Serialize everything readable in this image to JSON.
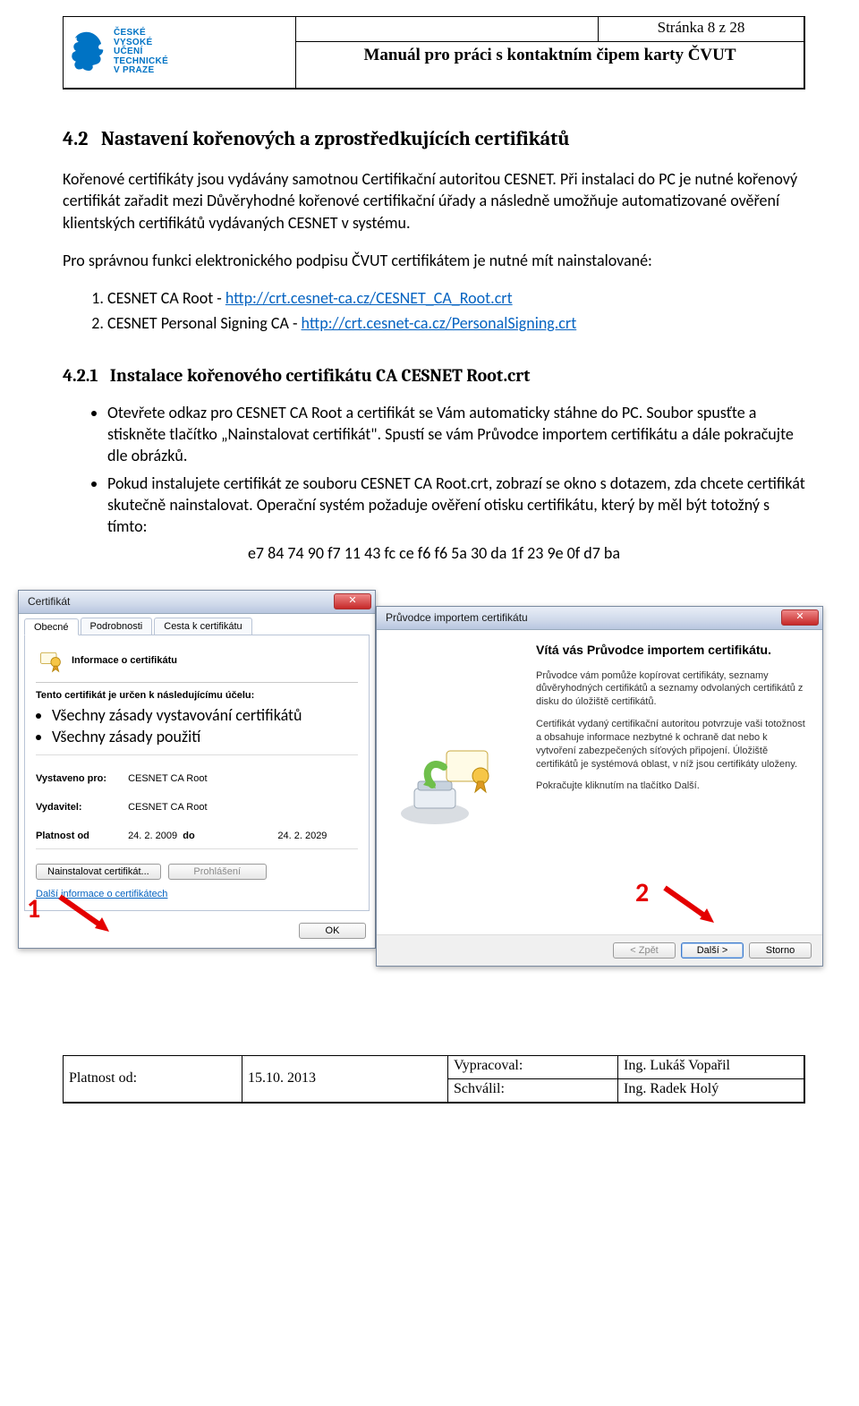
{
  "header": {
    "uni_lines": [
      "ČESKÉ",
      "VYSOKÉ",
      "UČENÍ",
      "TECHNICKÉ",
      "V PRAZE"
    ],
    "page_label": "Stránka 8 z 28",
    "title": "Manuál pro práci s kontaktním čipem karty ČVUT"
  },
  "sec": {
    "num": "4.2",
    "title": "Nastavení kořenových a zprostředkujících certifikátů",
    "p1": "Kořenové certifikáty jsou vydávány samotnou Certifikační autoritou CESNET. Při instalaci do PC je nutné kořenový certifikát zařadit mezi Důvěryhodné kořenové certifikační úřady a následně umožňuje automatizované ověření klientských certifikátů vydávaných CESNET v systému.",
    "p2": "Pro správnou funkci elektronického podpisu ČVUT certifikátem je nutné mít nainstalované:",
    "li1a": "CESNET CA Root - ",
    "li1_link": "http://crt.cesnet-ca.cz/CESNET_CA_Root.crt",
    "li2a": "CESNET Personal Signing CA - ",
    "li2_link": "http://crt.cesnet-ca.cz/PersonalSigning.crt"
  },
  "subsec": {
    "num": "4.2.1",
    "title": "Instalace kořenového certifikátu CA CESNET Root.crt",
    "b1": "Otevřete odkaz pro CESNET CA Root a certifikát se Vám automaticky stáhne do PC. Soubor spusťte a stiskněte tlačítko „Nainstalovat certifikát\". Spustí se vám Průvodce importem certifikátu a dále pokračujte dle obrázků.",
    "b2": "Pokud instalujete certifikát ze souboru CESNET CA Root.crt, zobrazí se okno s dotazem, zda chcete certifikát skutečně nainstalovat. Operační systém požaduje ověření otisku certifikátu, který by měl být totožný s tímto:",
    "hash": "e7 84 74 90 f7 11 43 fc ce f6 f6 5a 30 da 1f 23 9e 0f d7 ba"
  },
  "cert_win": {
    "title": "Certifikát",
    "tabs": [
      "Obecné",
      "Podrobnosti",
      "Cesta k certifikátu"
    ],
    "info_heading": "Informace o certifikátu",
    "purpose_label": "Tento certifikát je určen k následujícímu účelu:",
    "purpose_items": [
      "Všechny zásady vystavování certifikátů",
      "Všechny zásady použití"
    ],
    "issued_to_label": "Vystaveno pro:",
    "issued_to": "CESNET CA Root",
    "issuer_label": "Vydavitel:",
    "issuer": "CESNET CA Root",
    "valid_label_from": "Platnost od",
    "valid_from": "24. 2. 2009",
    "valid_label_to": "do",
    "valid_to": "24. 2. 2029",
    "btn_install": "Nainstalovat certifikát...",
    "btn_statement": "Prohlášení",
    "more_info_prefix": "Další informace o ",
    "more_info_link": "certifikátech",
    "btn_ok": "OK"
  },
  "wiz_win": {
    "title": "Průvodce importem certifikátu",
    "heading": "Vítá vás Průvodce importem certifikátu.",
    "p1": "Průvodce vám pomůže kopírovat certifikáty, seznamy důvěryhodných certifikátů a seznamy odvolaných certifikátů z disku do úložiště certifikátů.",
    "p2": "Certifikát vydaný certifikační autoritou potvrzuje vaši totožnost a obsahuje informace nezbytné k ochraně dat nebo k vytvoření zabezpečených síťových připojení. Úložiště certifikátů je systémová oblast, v níž jsou certifikáty uloženy.",
    "p3": "Pokračujte kliknutím na tlačítko Další.",
    "btn_back": "< Zpět",
    "btn_next": "Další >",
    "btn_cancel": "Storno"
  },
  "ann": {
    "one": "1",
    "two": "2"
  },
  "footer": {
    "l1": "Vypracoval:",
    "l2": "Schválil:",
    "n1": "Ing. Lukáš Vopařil",
    "n2": "Ing. Radek Holý",
    "valid_label": "Platnost od:",
    "date": "15.10. 2013"
  }
}
